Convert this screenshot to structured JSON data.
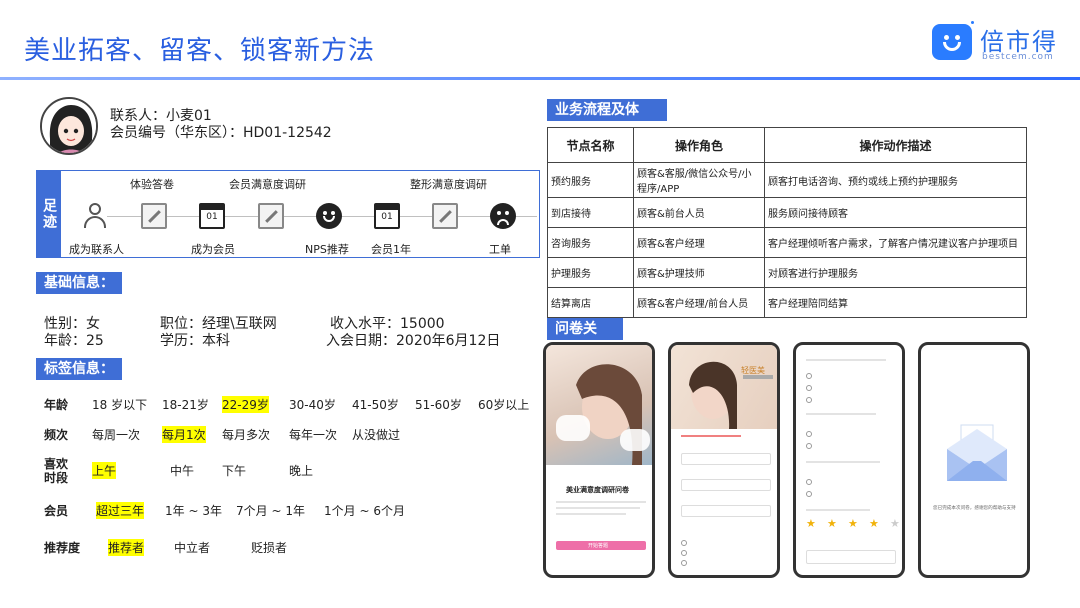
{
  "page": {
    "title": "美业拓客、留客、锁客新方法",
    "logo_text": "倍市得",
    "logo_sub": "bestcem.com"
  },
  "contact": {
    "line1": "联系人：小麦01",
    "line2": "会员编号（华东区）：HD01-12542"
  },
  "footprint": {
    "side_label": "足迹",
    "top_labels": [
      "体验答卷",
      "会员满意度调研",
      "整形满意度调研"
    ],
    "bottom_labels": [
      "成为联系人",
      "成为会员",
      "NPS推荐",
      "会员1年",
      "工单"
    ],
    "calendar_day": "01"
  },
  "basic": {
    "tag": "基础信息：",
    "gender": "性别：女",
    "position": "职位：经理\\互联网",
    "income": "收入水平：15000",
    "age": "年龄：25",
    "education": "学历：本科",
    "join_date": "入会日期：2020年6月12日"
  },
  "tags": {
    "tag": "标签信息：",
    "rows": [
      {
        "label": "年龄",
        "options": [
          "18 岁以下",
          "18-21岁",
          "22-29岁",
          "30-40岁",
          "41-50岁",
          "51-60岁",
          "60岁以上"
        ],
        "selected": 2
      },
      {
        "label": "频次",
        "options": [
          "每周一次",
          "每月1次",
          "每月多次",
          "每年一次",
          "从没做过"
        ],
        "selected": 1
      },
      {
        "label": "喜欢时段",
        "options": [
          "上午",
          "中午",
          "下午",
          "晚上"
        ],
        "selected": 0
      },
      {
        "label": "会员",
        "options": [
          "超过三年",
          "1年 ~ 3年",
          "7个月 ~ 1年",
          "1个月 ~ 6个月"
        ],
        "selected": 0
      },
      {
        "label": "推荐度",
        "options": [
          "推荐者",
          "中立者",
          "贬损者"
        ],
        "selected": 0
      }
    ]
  },
  "process": {
    "tag": "业务流程及体系：",
    "headers": [
      "节点名称",
      "操作角色",
      "操作动作描述"
    ],
    "rows": [
      [
        "预约服务",
        "顾客&客服/微信公众号/小程序/APP",
        "顾客打电话咨询、预约或线上预约护理服务"
      ],
      [
        "到店接待",
        "顾客&前台人员",
        "服务顾问接待顾客"
      ],
      [
        "咨询服务",
        "顾客&客户经理",
        "客户经理倾听客户需求，了解客户情况建议客户护理项目"
      ],
      [
        "护理服务",
        "顾客&护理技师",
        "对顾客进行护理服务"
      ],
      [
        "结算离店",
        "顾客&客户经理/前台人员",
        "客户经理陪同结算"
      ]
    ]
  },
  "survey": {
    "tag": "问卷关联：",
    "phone1_title": "美业满意度调研问卷",
    "phone1_button": "开始答题",
    "phone2_banner": "轻医美",
    "phone3_stars": 4,
    "phone4_text": "您已完成本次问卷，感谢您的帮助与支持"
  },
  "colors": {
    "brand": "#2a5fe0",
    "tag_bg": "#3f6ed6",
    "highlight": "#ffff00"
  }
}
